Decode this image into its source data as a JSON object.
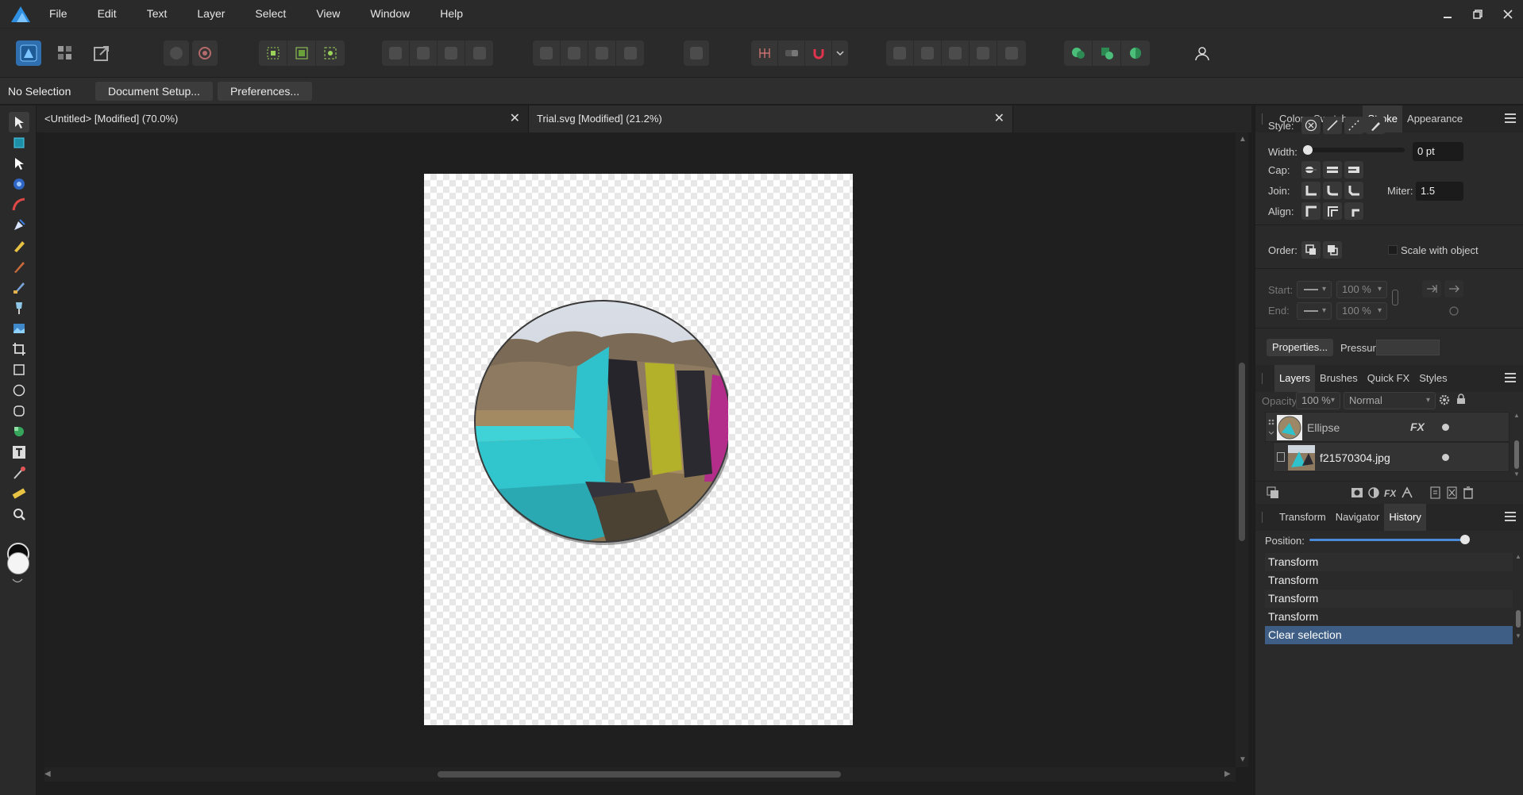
{
  "app": {
    "menu": [
      "File",
      "Edit",
      "Text",
      "Layer",
      "Select",
      "View",
      "Window",
      "Help"
    ],
    "window_controls": [
      "minimize-icon",
      "restore-icon",
      "close-icon"
    ],
    "colors": {
      "accent": "#2f8fe0",
      "selection": "#3e5e86",
      "background": "#1e1e1e"
    }
  },
  "context_bar": {
    "status": "No Selection",
    "document_setup_label": "Document Setup...",
    "preferences_label": "Preferences..."
  },
  "documents": [
    {
      "title": "<Untitled> [Modified] (70.0%)"
    },
    {
      "title": "Trial.svg [Modified] (21.2%)"
    }
  ],
  "close_symbol": "✕",
  "stroke_panel": {
    "tabs": [
      "Color",
      "Swatches",
      "Stroke",
      "Appearance"
    ],
    "active_tab": "Stroke",
    "style_label": "Style:",
    "width_label": "Width:",
    "width_value": "0 pt",
    "width_fraction": 0.0,
    "cap_label": "Cap:",
    "join_label": "Join:",
    "miter_label": "Miter:",
    "miter_value": "1.5",
    "align_label": "Align:",
    "order_label": "Order:",
    "scale_with_object_label": "Scale with object",
    "start_label": "Start:",
    "end_label": "End:",
    "start_scale": "100 %",
    "end_scale": "100 %",
    "properties_label": "Properties...",
    "pressure_label": "Pressure:"
  },
  "layers_panel": {
    "tabs": [
      "Layers",
      "Brushes",
      "Quick FX",
      "Styles"
    ],
    "active_tab": "Layers",
    "opacity_label": "Opacity:",
    "opacity_value": "100 %",
    "blend_mode": "Normal",
    "fx_label": "FX",
    "layers": [
      {
        "name": "Ellipse",
        "has_fx": true
      },
      {
        "name": "f21570304.jpg",
        "has_fx": false
      }
    ]
  },
  "history_panel": {
    "tabs": [
      "Transform",
      "Navigator",
      "History"
    ],
    "active_tab": "History",
    "position_label": "Position:",
    "position_fraction": 1.0,
    "entries": [
      "Transform",
      "Transform",
      "Transform",
      "Transform",
      "Clear selection"
    ],
    "selected_index": 4
  }
}
